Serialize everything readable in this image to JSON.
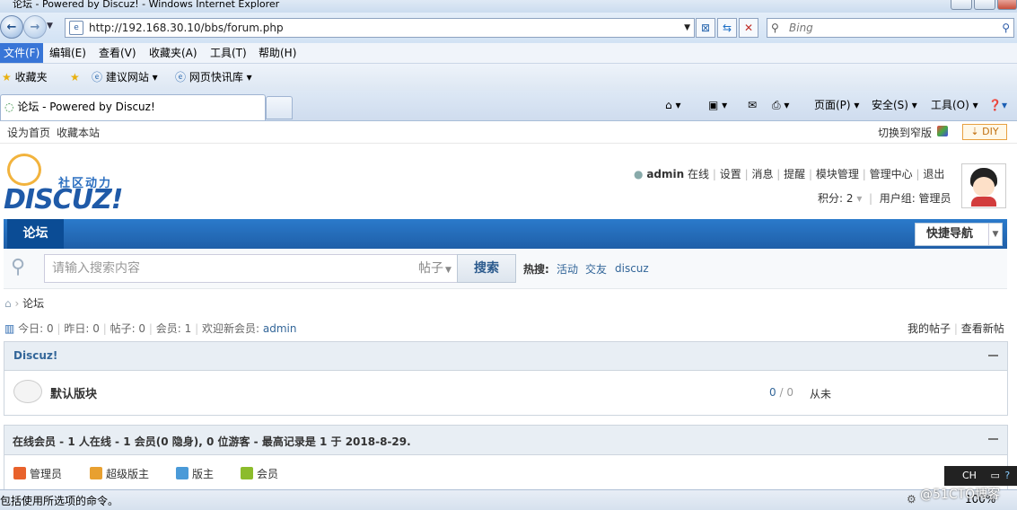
{
  "window": {
    "title": "论坛 - Powered by Discuz! - Windows Internet Explorer"
  },
  "browser": {
    "url": "http://192.168.30.10/bbs/forum.php",
    "search_placeholder": "Bing",
    "menu": [
      "文件(F)",
      "编辑(E)",
      "查看(V)",
      "收藏夹(A)",
      "工具(T)",
      "帮助(H)"
    ],
    "favorites": {
      "label": "收藏夹",
      "items": [
        "建议网站",
        "网页快讯库"
      ]
    },
    "tab_title": "论坛 - Powered by Discuz!",
    "tools": {
      "page": "页面(P)",
      "safety": "安全(S)",
      "tools": "工具(O)"
    },
    "status_text": "包括使用所选项的命令。",
    "zoom": "100%",
    "ime": "CH"
  },
  "topbar": {
    "set_home": "设为首页",
    "bookmark": "收藏本站",
    "switch_width": "切换到窄版",
    "diy": "DIY"
  },
  "header": {
    "logo_text": "DISCUZ!",
    "logo_slogan": "社区动力",
    "user": "admin",
    "online": "在线",
    "links": [
      "设置",
      "消息",
      "提醒",
      "模块管理",
      "管理中心",
      "退出"
    ],
    "credits_label": "积分: 2",
    "usergroup": "用户组: 管理员"
  },
  "nav": {
    "current": "论坛",
    "quicknav": "快捷导航"
  },
  "search": {
    "placeholder": "请输入搜索内容",
    "type": "帖子",
    "button": "搜索",
    "hot_label": "热搜:",
    "hot": [
      "活动",
      "交友",
      "discuz"
    ]
  },
  "breadcrumb": {
    "current": "论坛"
  },
  "stats": {
    "today": "今日: 0",
    "yesterday": "昨日: 0",
    "posts": "帖子: 0",
    "members": "会员: 1",
    "welcome": "欢迎新会员:",
    "newest": "admin",
    "my_posts": "我的帖子",
    "new_posts": "查看新帖"
  },
  "category": {
    "name": "Discuz!",
    "forum": {
      "name": "默认版块",
      "counts_a": "0",
      "counts_sep": "/",
      "counts_b": "0",
      "last": "从未"
    }
  },
  "online": {
    "summary": "在线会员 - 1 人在线 - 1 会员(0 隐身), 0 位游客 - 最高记录是 1 于 2018-8-29.",
    "legend": [
      {
        "label": "管理员",
        "color": "#e8622c"
      },
      {
        "label": "超级版主",
        "color": "#e8a030"
      },
      {
        "label": "版主",
        "color": "#4a9ad8"
      },
      {
        "label": "会员",
        "color": "#8cbc2c"
      }
    ]
  },
  "watermark": "@51CTO博客"
}
